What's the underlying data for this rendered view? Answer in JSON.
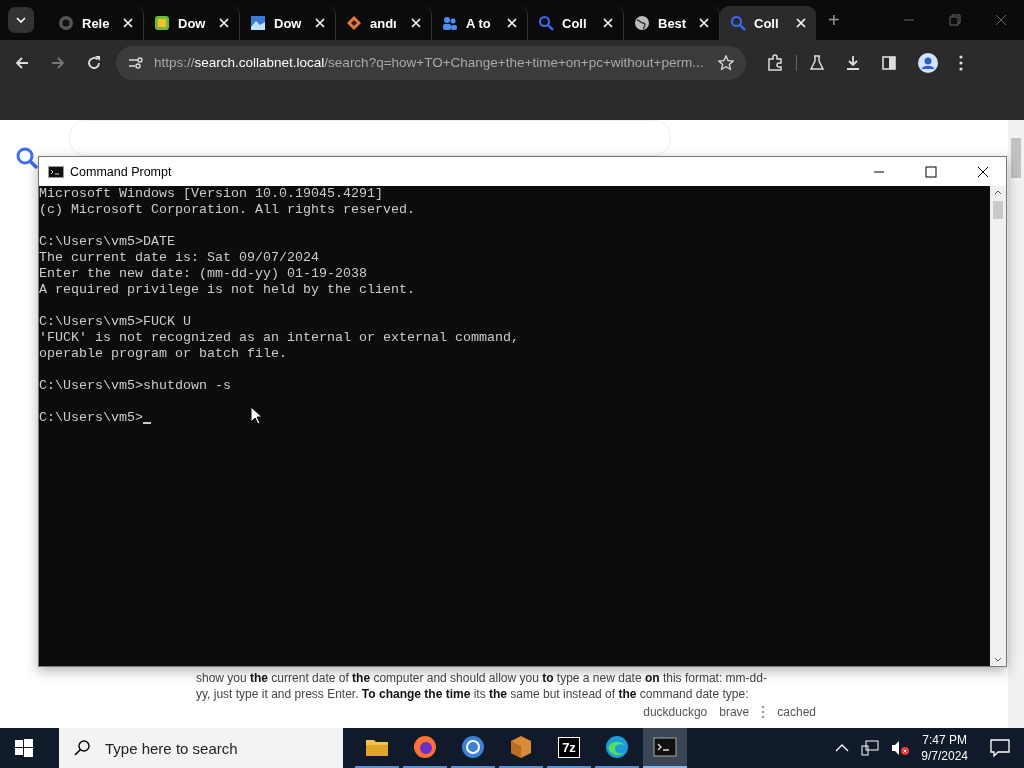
{
  "browser": {
    "tabs": [
      {
        "label": "Rele",
        "kind": "github",
        "selected": false
      },
      {
        "label": "Dow",
        "kind": "app",
        "selected": false
      },
      {
        "label": "Dow",
        "kind": "image",
        "selected": false
      },
      {
        "label": "andı",
        "kind": "diamond",
        "selected": false
      },
      {
        "label": "A to",
        "kind": "people",
        "selected": false
      },
      {
        "label": "Coll",
        "kind": "search",
        "selected": false
      },
      {
        "label": "Best",
        "kind": "globe",
        "selected": false
      },
      {
        "label": "Coll",
        "kind": "search",
        "selected": true
      }
    ],
    "new_tab": "+",
    "address": {
      "scheme": "https://",
      "host": "search.collabnet.local",
      "path": "/search?q=how+TO+Change+the+time+on+pc+without+perm..."
    }
  },
  "page": {
    "result": {
      "lines": [
        "show you **the** current date of **the** computer and should allow you **to** type a new date **on** this format: mm-dd-",
        "yy, just type it and press Enter. **To change the time** its **the** same but instead of **the** command date type:"
      ],
      "links": [
        "duckduckgo",
        "brave"
      ],
      "cached": "cached"
    }
  },
  "console": {
    "title": "Command Prompt",
    "blocks": [
      [
        "Microsoft Windows [Version 10.0.19045.4291]",
        "(c) Microsoft Corporation. All rights reserved."
      ],
      [
        "C:\\Users\\vm5>DATE",
        "The current date is: Sat 09/07/2024",
        "Enter the new date: (mm-dd-yy) 01-19-2038",
        "A required privilege is not held by the client."
      ],
      [
        "C:\\Users\\vm5>FUCK U",
        "'FUCK' is not recognized as an internal or external command,",
        "operable program or batch file."
      ],
      [
        "C:\\Users\\vm5>shutdown -s"
      ]
    ],
    "prompt": "C:\\Users\\vm5>"
  },
  "taskbar": {
    "search": {
      "placeholder": "Type here to search"
    },
    "apps": [
      {
        "kind": "folder",
        "selected": false
      },
      {
        "kind": "firefox",
        "selected": false
      },
      {
        "kind": "chrome",
        "selected": false
      },
      {
        "kind": "package",
        "selected": false
      },
      {
        "kind": "sevenzip",
        "label": "7z",
        "selected": false
      },
      {
        "kind": "edge",
        "selected": false
      },
      {
        "kind": "terminal",
        "selected": true
      }
    ],
    "time": "7:47 PM",
    "date": "9/7/2024"
  }
}
